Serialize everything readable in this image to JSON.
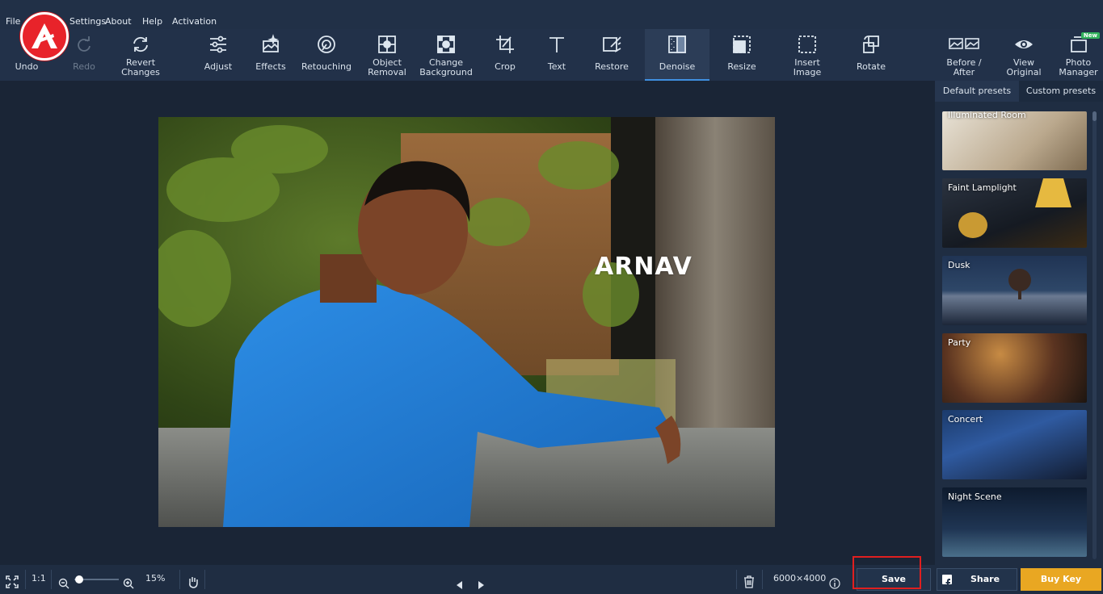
{
  "menu": [
    "File",
    "Settings",
    "About",
    "Help",
    "Activation"
  ],
  "toolbar": [
    {
      "label": "Undo",
      "icon": "undo-icon"
    },
    {
      "label": "Redo",
      "icon": "redo-icon",
      "disabled": true
    },
    {
      "label": "Revert Changes",
      "icon": "revert-icon"
    },
    {
      "label": "Adjust",
      "icon": "sliders-icon"
    },
    {
      "label": "Effects",
      "icon": "effects-icon"
    },
    {
      "label": "Retouching",
      "icon": "retouch-icon"
    },
    {
      "label": "Object Removal",
      "icon": "object-removal-icon"
    },
    {
      "label": "Change Background",
      "icon": "change-background-icon"
    },
    {
      "label": "Crop",
      "icon": "crop-icon"
    },
    {
      "label": "Text",
      "icon": "text-icon"
    },
    {
      "label": "Restore",
      "icon": "restore-icon"
    },
    {
      "label": "Denoise",
      "icon": "denoise-icon",
      "active": true
    },
    {
      "label": "Resize",
      "icon": "resize-icon"
    },
    {
      "label": "Insert Image",
      "icon": "insert-image-icon"
    },
    {
      "label": "Rotate",
      "icon": "rotate-icon"
    },
    {
      "label": "Before / After",
      "icon": "before-after-icon"
    },
    {
      "label": "View Original",
      "icon": "eye-icon"
    },
    {
      "label": "Photo Manager",
      "icon": "photo-manager-icon",
      "badge": "New"
    }
  ],
  "photo": {
    "overlay_text": "ARNAV"
  },
  "side_panel": {
    "tabs": [
      "Default presets",
      "Custom presets"
    ],
    "active_tab": "Default presets",
    "presets": [
      "Illuminated Room",
      "Faint Lamplight",
      "Dusk",
      "Party",
      "Concert",
      "Night Scene"
    ]
  },
  "bottom": {
    "ratio_label": "1:1",
    "zoom": "15%",
    "zoom_fraction": 0.1,
    "dimensions": "6000×4000",
    "save_label": "Save",
    "share_label": "Share",
    "buy_label": "Buy Key"
  },
  "colors": {
    "accent": "#3f8fe0",
    "buy": "#e9a722",
    "highlight": "#e01f1f",
    "logo": "#e8232a"
  }
}
